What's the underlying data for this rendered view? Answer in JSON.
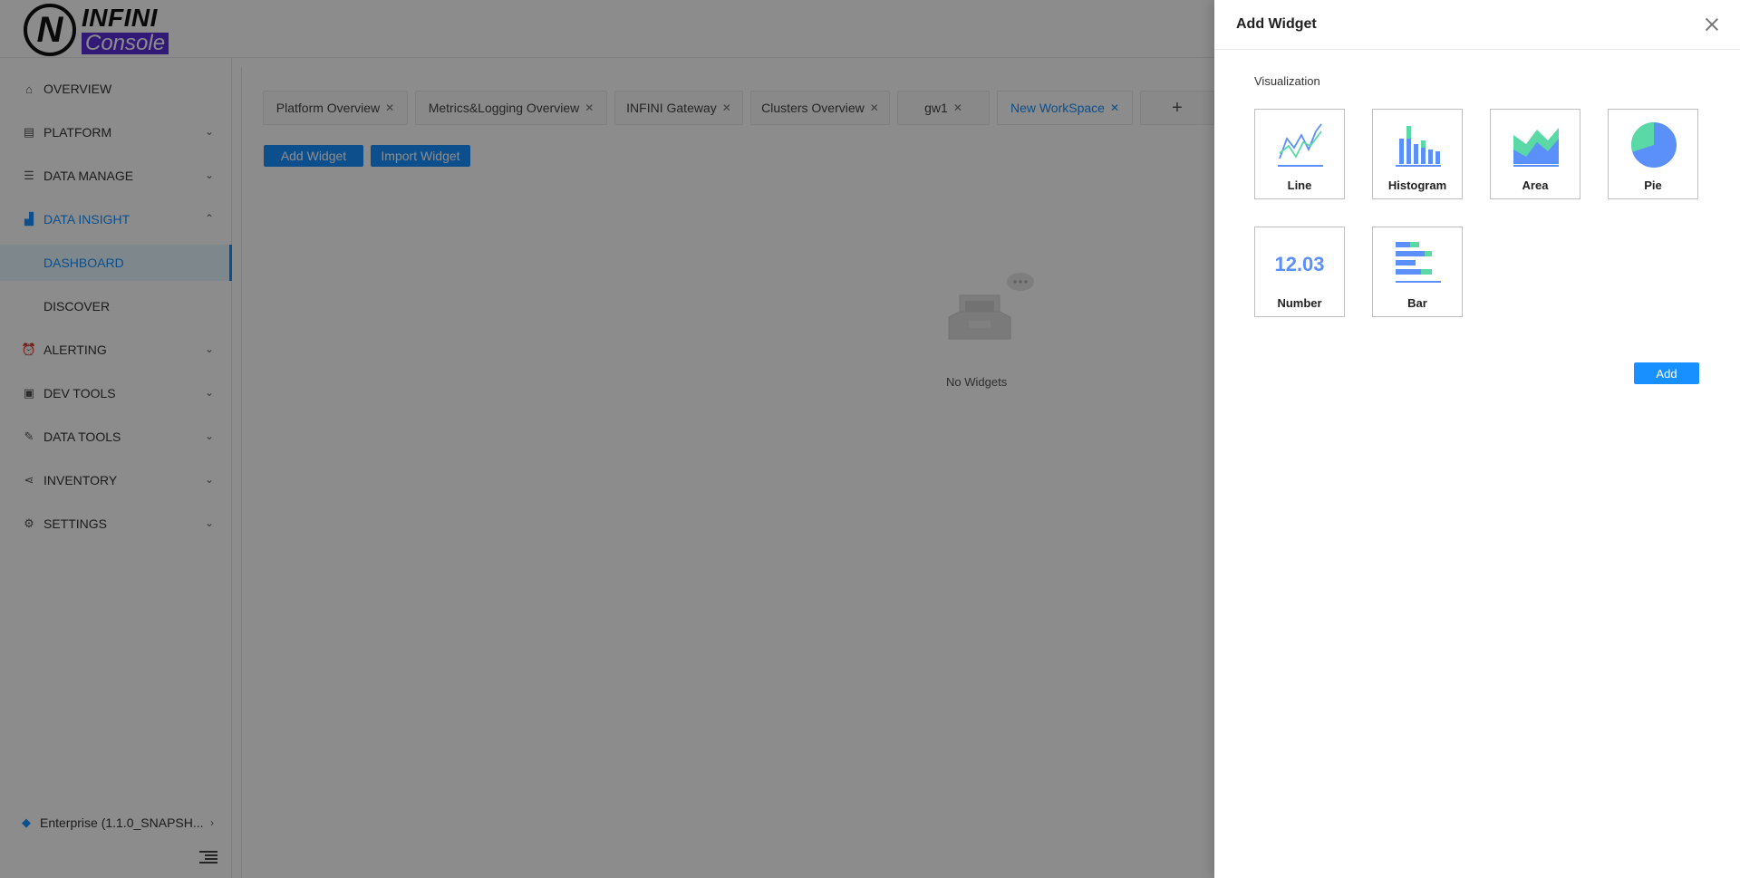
{
  "logo": {
    "line1": "INFINI",
    "line2": "Console"
  },
  "sidebar": {
    "items": [
      {
        "label": "OVERVIEW",
        "icon": "home-icon"
      },
      {
        "label": "PLATFORM",
        "icon": "platform-icon"
      },
      {
        "label": "DATA MANAGE",
        "icon": "data-manage-icon"
      },
      {
        "label": "DATA INSIGHT",
        "icon": "chart-icon"
      },
      {
        "label": "DASHBOARD"
      },
      {
        "label": "DISCOVER"
      },
      {
        "label": "ALERTING",
        "icon": "alarm-icon"
      },
      {
        "label": "DEV TOOLS",
        "icon": "terminal-icon"
      },
      {
        "label": "DATA TOOLS",
        "icon": "wrench-icon"
      },
      {
        "label": "INVENTORY",
        "icon": "share-icon"
      },
      {
        "label": "SETTINGS",
        "icon": "gear-icon"
      }
    ],
    "footer": "Enterprise (1.1.0_SNAPSH..."
  },
  "tabs": [
    {
      "label": "Platform Overview"
    },
    {
      "label": "Metrics&Logging Overview"
    },
    {
      "label": "INFINI Gateway"
    },
    {
      "label": "Clusters Overview"
    },
    {
      "label": "gw1"
    },
    {
      "label": "New WorkSpace"
    },
    {
      "label": "+"
    }
  ],
  "toolbar": {
    "add_widget": "Add Widget",
    "import_widget": "Import Widget"
  },
  "empty_state": {
    "label": "No Widgets"
  },
  "drawer": {
    "title": "Add Widget",
    "section": "Visualization",
    "types": [
      {
        "label": "Line",
        "icon": "line-chart-icon"
      },
      {
        "label": "Histogram",
        "icon": "histogram-icon"
      },
      {
        "label": "Area",
        "icon": "area-chart-icon"
      },
      {
        "label": "Pie",
        "icon": "pie-chart-icon"
      },
      {
        "label": "Number",
        "icon": "number-icon",
        "sample": "12.03"
      },
      {
        "label": "Bar",
        "icon": "bar-chart-icon"
      }
    ],
    "add_button": "Add"
  },
  "colors": {
    "primary": "#1890ff",
    "chart_blue": "#5b8ff9",
    "chart_green": "#5ad8a6",
    "brand_purple": "#5b2fd9"
  }
}
